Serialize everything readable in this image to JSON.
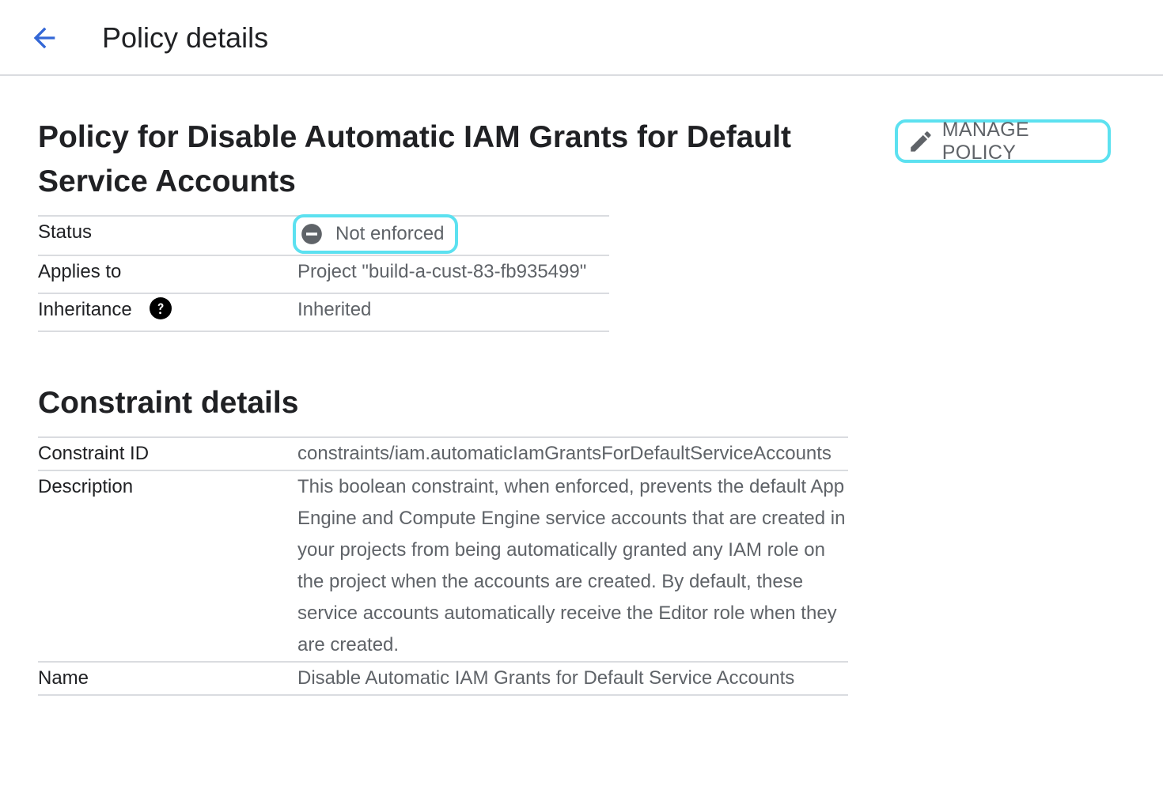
{
  "header": {
    "back_icon": "arrow-left-icon",
    "title": "Policy details"
  },
  "policy": {
    "title": "Policy for Disable Automatic IAM Grants for Default Service Accounts",
    "manage_button": {
      "icon": "pencil-icon",
      "label": "MANAGE POLICY"
    },
    "rows": {
      "status": {
        "key": "Status",
        "value": "Not enforced",
        "icon": "minus-circle-icon"
      },
      "applies_to": {
        "key": "Applies to",
        "value": "Project \"build-a-cust-83-fb935499\""
      },
      "inheritance": {
        "key": "Inheritance",
        "value": "Inherited",
        "help_icon": "help-circle-icon"
      }
    }
  },
  "constraint": {
    "title": "Constraint details",
    "rows": {
      "id": {
        "key": "Constraint ID",
        "value": "constraints/iam.automaticIamGrantsForDefaultServiceAccounts"
      },
      "description": {
        "key": "Description",
        "value": "This boolean constraint, when enforced, prevents the default App Engine and Compute Engine service accounts that are created in your projects from being automatically granted any IAM role on the project when the accounts are created. By default, these service accounts automatically receive the Editor role when they are created."
      },
      "name": {
        "key": "Name",
        "value": "Disable Automatic IAM Grants for Default Service Accounts"
      }
    }
  },
  "colors": {
    "accent": "#3367d6",
    "highlight": "#5ce1f0",
    "text_primary": "#202124",
    "text_secondary": "#5f6368",
    "divider": "#dadce0"
  }
}
